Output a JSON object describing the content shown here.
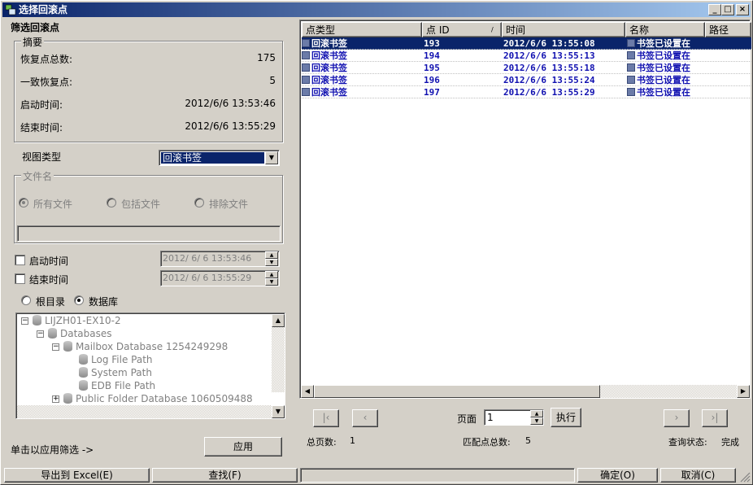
{
  "window": {
    "title": "选择回滚点",
    "min": "_",
    "max": "□",
    "close": "×"
  },
  "left": {
    "heading": "筛选回滚点",
    "summary": {
      "title": "摘要",
      "rows": [
        {
          "label": "恢复点总数:",
          "value": "175"
        },
        {
          "label": "一致恢复点:",
          "value": "5"
        },
        {
          "label": "启动时间:",
          "value": "2012/6/6 13:53:46"
        },
        {
          "label": "结束时间:",
          "value": "2012/6/6 13:55:29"
        }
      ]
    },
    "view_type_label": "视图类型",
    "view_type_value": "回滚书签",
    "filename": {
      "title": "文件名",
      "options": [
        "所有文件",
        "包括文件",
        "排除文件"
      ]
    },
    "start_time_label": "启动时间",
    "start_time_value": "2012/ 6/ 6 13:53:46",
    "end_time_label": "结束时间",
    "end_time_value": "2012/ 6/ 6 13:55:29",
    "root_label": "根目录",
    "db_label": "数据库",
    "tree": [
      "LIJZH01-EX10-2",
      "Databases",
      "Mailbox Database 1254249298",
      "Log File Path",
      "System Path",
      "EDB File Path",
      "Public Folder Database 1060509488"
    ],
    "apply_hint": "单击以应用筛选 ->",
    "apply_button": "应用"
  },
  "grid": {
    "columns": [
      "点类型",
      "点 ID",
      "时间",
      "名称",
      "路径"
    ],
    "rows": [
      {
        "type": "回滚书签",
        "id": "193",
        "time": "2012/6/6 13:55:08",
        "name": "书签已设置在"
      },
      {
        "type": "回滚书签",
        "id": "194",
        "time": "2012/6/6 13:55:13",
        "name": "书签已设置在"
      },
      {
        "type": "回滚书签",
        "id": "195",
        "time": "2012/6/6 13:55:18",
        "name": "书签已设置在"
      },
      {
        "type": "回滚书签",
        "id": "196",
        "time": "2012/6/6 13:55:24",
        "name": "书签已设置在"
      },
      {
        "type": "回滚书签",
        "id": "197",
        "time": "2012/6/6 13:55:29",
        "name": "书签已设置在"
      }
    ]
  },
  "pager": {
    "page_label": "页面",
    "page_value": "1",
    "go_button": "执行",
    "total_pages_label": "总页数:",
    "total_pages": "1",
    "match_label": "匹配点总数:",
    "match_count": "5",
    "status_label": "查询状态:",
    "status_value": "完成"
  },
  "bottom": {
    "export": "导出到 Excel(E)",
    "find": "查找(F)",
    "ok": "确定(O)",
    "cancel": "取消(C)"
  }
}
